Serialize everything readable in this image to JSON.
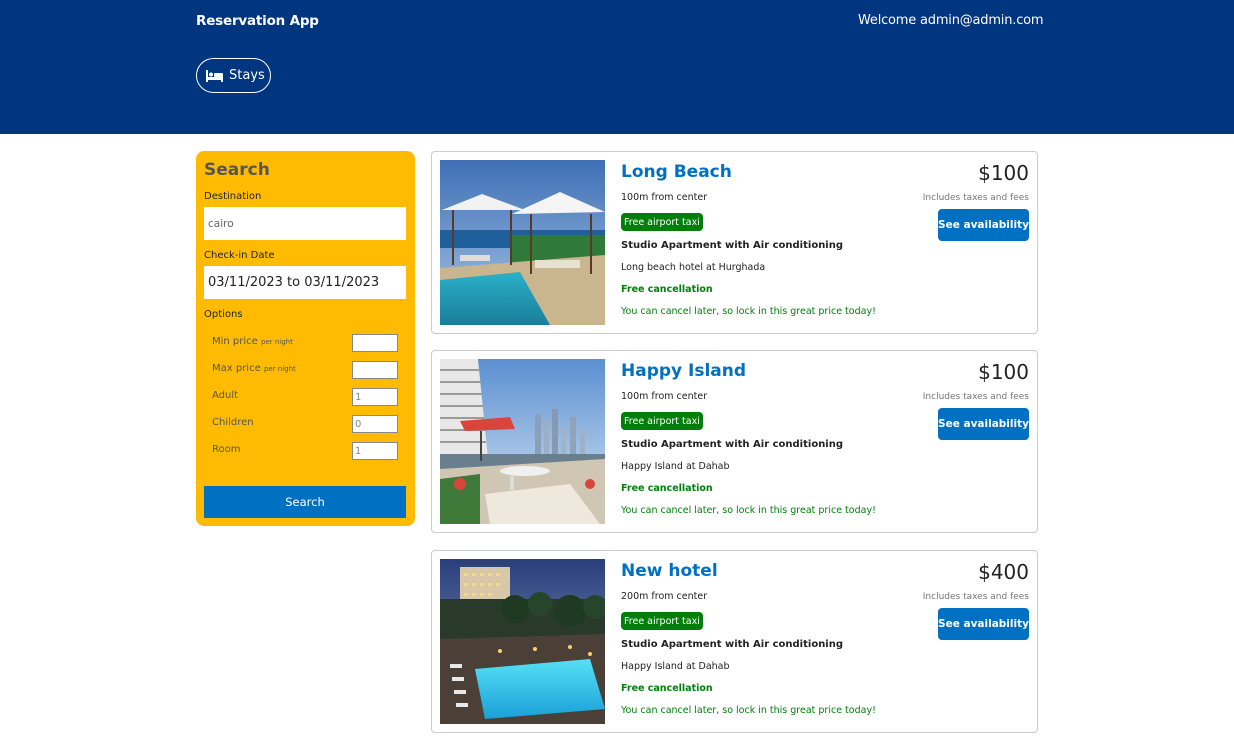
{
  "header": {
    "brand": "Reservation App",
    "welcome": "Welcome admin@admin.com",
    "nav": {
      "stays_label": "Stays",
      "stays_icon": "bed-icon"
    }
  },
  "search": {
    "title": "Search",
    "destination_label": "Destination",
    "destination_value": "cairo",
    "checkin_label": "Check-in Date",
    "checkin_value": "03/11/2023 to 03/11/2023",
    "options_label": "Options",
    "options": [
      {
        "label": "Min price",
        "suffix": "per night",
        "value": ""
      },
      {
        "label": "Max price",
        "suffix": "per night",
        "value": ""
      },
      {
        "label": "Adult",
        "suffix": "",
        "value": "1"
      },
      {
        "label": "Children",
        "suffix": "",
        "value": "0"
      },
      {
        "label": "Room",
        "suffix": "",
        "value": "1"
      }
    ],
    "button_label": "Search"
  },
  "results": [
    {
      "name": "Long Beach",
      "distance": "100m from center",
      "taxi": "Free airport taxi",
      "subtitle": "Studio Apartment with Air conditioning",
      "description": "Long beach hotel at Hurghada",
      "cancel": "Free cancellation",
      "cancel_sub": "You can cancel later, so lock in this great price today!",
      "price": "$100",
      "tax_note": "Includes taxes and fees",
      "availability": "See availability"
    },
    {
      "name": "Happy Island",
      "distance": "100m from center",
      "taxi": "Free airport taxi",
      "subtitle": "Studio Apartment with Air conditioning",
      "description": "Happy Island at Dahab",
      "cancel": "Free cancellation",
      "cancel_sub": "You can cancel later, so lock in this great price today!",
      "price": "$100",
      "tax_note": "Includes taxes and fees",
      "availability": "See availability"
    },
    {
      "name": "New hotel",
      "distance": "200m from center",
      "taxi": "Free airport taxi",
      "subtitle": "Studio Apartment with Air conditioning",
      "description": "Happy Island at Dahab",
      "cancel": "Free cancellation",
      "cancel_sub": "You can cancel later, so lock in this great price today!",
      "price": "$400",
      "tax_note": "Includes taxes and fees",
      "availability": "See availability"
    }
  ],
  "colors": {
    "header_bg": "#003580",
    "sidebar_bg": "#febb02",
    "primary": "#0071c2",
    "success": "#008009"
  }
}
